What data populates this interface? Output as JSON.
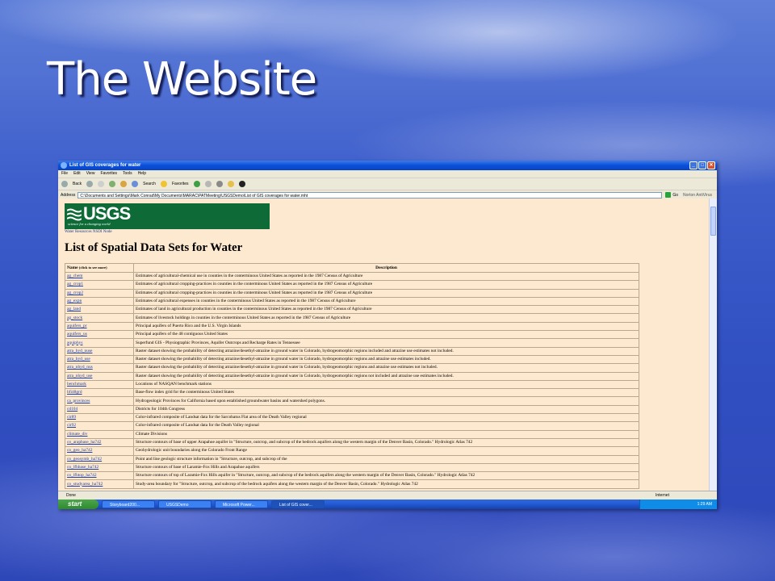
{
  "slide": {
    "title": "The Website"
  },
  "window": {
    "title": "List of GIS coverages for water",
    "controls": {
      "minimize": "_",
      "maximize": "□",
      "close": "✕"
    }
  },
  "menubar": [
    "File",
    "Edit",
    "View",
    "Favorites",
    "Tools",
    "Help"
  ],
  "toolbar": {
    "back": "Back",
    "search": "Search",
    "favorites": "Favorites"
  },
  "address": {
    "label": "Address",
    "value": "C:\\Documents and Settings\\Mark Conrad\\My Documents\\MARAC\\PATMeeting\\USGSDemo\\List of GIS coverages for water.mht",
    "go": "Go",
    "norton": "Norton AntiVirus"
  },
  "page": {
    "logo_text": "USGS",
    "logo_tagline": "science for a changing world",
    "node": "Water Resources NSDI Node",
    "heading": "List of Spatial Data Sets for Water",
    "table": {
      "headers": {
        "name": "Name",
        "name_hint": "(click to see more)",
        "description": "Description"
      },
      "rows": [
        {
          "name": "ag_chem",
          "desc": "Estimates of agricultural-chemical use in counties in the conterminous United States as reported in the 1987 Census of Agriculture"
        },
        {
          "name": "ag_crop1",
          "desc": "Estimates of agricultural cropping-practices in counties in the conterminous United States as reported in the 1987 Census of Agriculture"
        },
        {
          "name": "ag_crop2",
          "desc": "Estimates of agricultural cropping-practices in counties in the conterminous United States as reported in the 1987 Census of Agriculture"
        },
        {
          "name": "ag_expn",
          "desc": "Estimates of agricultural expenses in counties in the conterminous United States as reported in the 1987 Census of Agriculture"
        },
        {
          "name": "ag_land",
          "desc": "Estimates of land in agricultural production in counties in the conterminous United States as reported in the 1987 Census of Agriculture"
        },
        {
          "name": "ag_stock",
          "desc": "Estimates of livestock holdings in counties in the conterminous United States as reported in the 1987 Census of Agriculture"
        },
        {
          "name": "aquifers_pr",
          "desc": "Principal aquifers of Puerto Rico and the U.S. Virgin Islands"
        },
        {
          "name": "aquifers_us",
          "desc": "Principal aquifers of the 48 contiguous United States"
        },
        {
          "name": "aquiphys",
          "desc": "Superfund GIS - Physiographic Provinces, Aquifer Outcrops and Recharge Rates in Tennessee"
        },
        {
          "name": "atra_hyd_nuse",
          "desc": "Raster dataset showing the probability of detecting atrazine/desethyl-atrazine in ground water in Colorado, hydrogeomorphic regions included and atrazine use estimates not included."
        },
        {
          "name": "atra_hyd_use",
          "desc": "Raster dataset showing the probability of detecting atrazine/desethyl-atrazine in ground water in Colorado, hydrogeomorphic regions and atrazine use estimates included."
        },
        {
          "name": "atra_nhyd_nus",
          "desc": "Raster dataset showing the probability of detecting atrazine/desethyl-atrazine in ground water in Colorado, hydrogeomorphic regions and atrazine use estimates not included."
        },
        {
          "name": "atra_nhyd_use",
          "desc": "Raster dataset showing the probability of detecting atrazine/desethyl-atrazine in ground water in Colorado, hydrogeomorphic regions not included and atrazine use estimates included."
        },
        {
          "name": "benchmark",
          "desc": "Locations of NASQAN benchmark stations"
        },
        {
          "name": "bfi48grd",
          "desc": "Base-flow index grid for the conterminous United States"
        },
        {
          "name": "ca_provinces",
          "desc": "Hydrogeologic Provinces for California based upon established groundwater basins and watershed polygons."
        },
        {
          "name": "cd104",
          "desc": "Districts for 104th Congress"
        },
        {
          "name": "cir89",
          "desc": "Color-infrared composite of Landsat data for the Sarcobatus Flat area of the Death Valley regional"
        },
        {
          "name": "cir92",
          "desc": "Color-infrared composite of Landsat data for the Death Valley regional"
        },
        {
          "name": "climate_div",
          "desc": "Climate Divisions"
        },
        {
          "name": "co_arapbase_ha742",
          "desc": "Structure contours of base of upper Arapahoe aquifer in \"Structure, outcrop, and subcrop of the bedrock aquifers along the western margin of the Denver Basin, Colorado.\" Hydrologic Atlas 742"
        },
        {
          "name": "co_geo_ha742",
          "desc": "Geohydrologic unit boundaries along the Colorado Front Range"
        },
        {
          "name": "co_geosymb_ha742",
          "desc": "Point and line geologic structure information in \"Structure, outcrop, and subcrop of the"
        },
        {
          "name": "co_lfhbase_ha742",
          "desc": "Structure contours of base of Laramie-Fox Hills and Arapahoe aquifers"
        },
        {
          "name": "co_lfhtop_ha742",
          "desc": "Structure contours of top of Laramie-Fox Hills aquifer in \"Structure, outcrop, and subcrop of the bedrock aquifers along the western margin of the Denver Basin, Colorado.\" Hydrologic Atlas 742"
        },
        {
          "name": "co_studyarea_ha742",
          "desc": "Study-area boundary for \"Structure, outcrop, and subcrop of the bedrock aquifers along the western margin of the Denver Basin, Colorado.\" Hydrologic Atlas 742"
        }
      ]
    }
  },
  "status": {
    "left": "Done",
    "zone": "Internet"
  },
  "taskbar": {
    "start": "start",
    "tasks": [
      "Storyboard200...",
      "USGSDemo",
      "Microsoft Power...",
      "List of GIS cover..."
    ],
    "clock": "1:29 AM"
  },
  "colors": {
    "usgs_green": "#0e6b37",
    "page_bg": "#fde9cf",
    "link": "#1f3fa0"
  }
}
